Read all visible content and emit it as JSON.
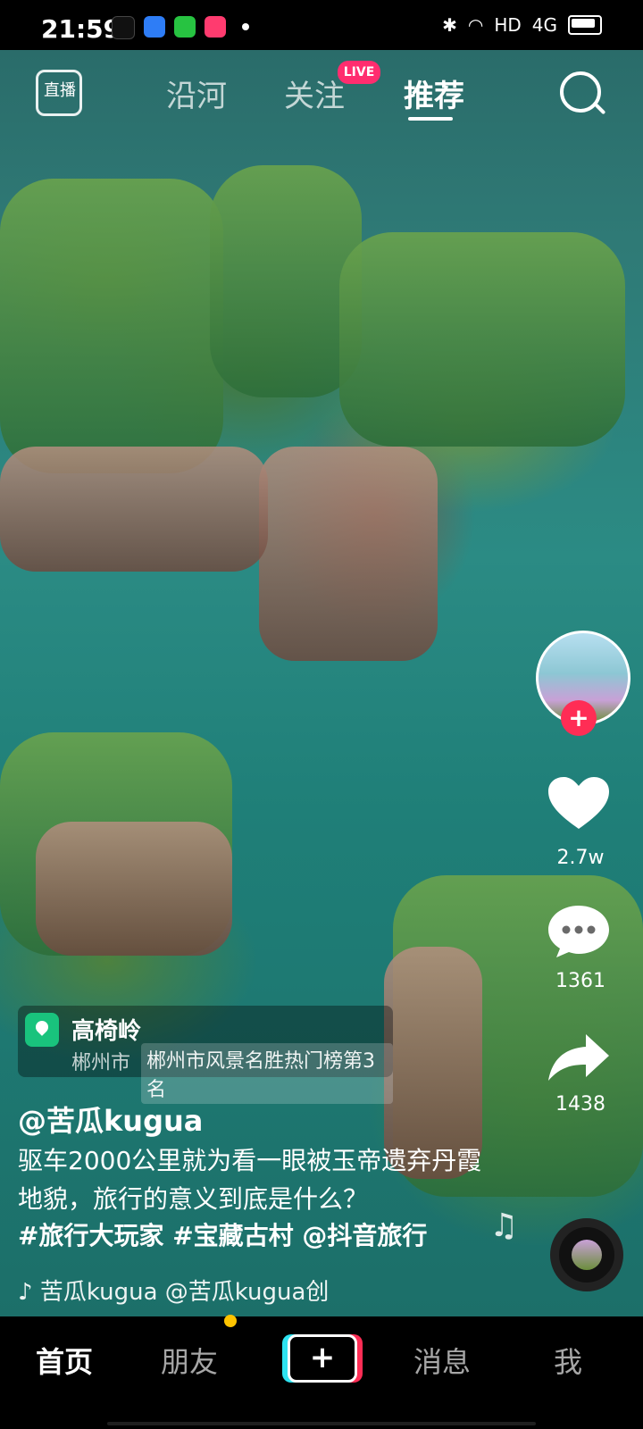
{
  "status_bar": {
    "time": "21:59",
    "network": "HD",
    "signal": "4G"
  },
  "top_nav": {
    "live_label": "直播",
    "tabs": [
      {
        "label": "沿河",
        "active": false
      },
      {
        "label": "关注",
        "active": false,
        "badge": "LIVE"
      },
      {
        "label": "推荐",
        "active": true
      }
    ]
  },
  "actions": {
    "likes": "2.7w",
    "comments": "1361",
    "shares": "1438",
    "follow_symbol": "+"
  },
  "poi": {
    "title": "高椅岭",
    "city": "郴州市",
    "rank": "郴州市风景名胜热门榜第3名"
  },
  "caption": {
    "author": "@苦瓜kugua",
    "text": "驱车2000公里就为看一眼被玉帝遗弃丹霞地貌，旅行的意义到底是什么？",
    "hashtags": "#旅行大玩家  #宝藏古村  @抖音旅行",
    "music": "♪ 苦瓜kugua    @苦瓜kugua创"
  },
  "bottom_tabs": [
    {
      "label": "首页",
      "active": true
    },
    {
      "label": "朋友",
      "active": false
    },
    {
      "label": "+",
      "active": false
    },
    {
      "label": "消息",
      "active": false
    },
    {
      "label": "我",
      "active": false
    }
  ],
  "colors": {
    "accent_pink": "#ff2d55",
    "accent_cyan": "#2ee3f1",
    "poi_green": "#19c37d",
    "notification_yellow": "#ffc400"
  }
}
